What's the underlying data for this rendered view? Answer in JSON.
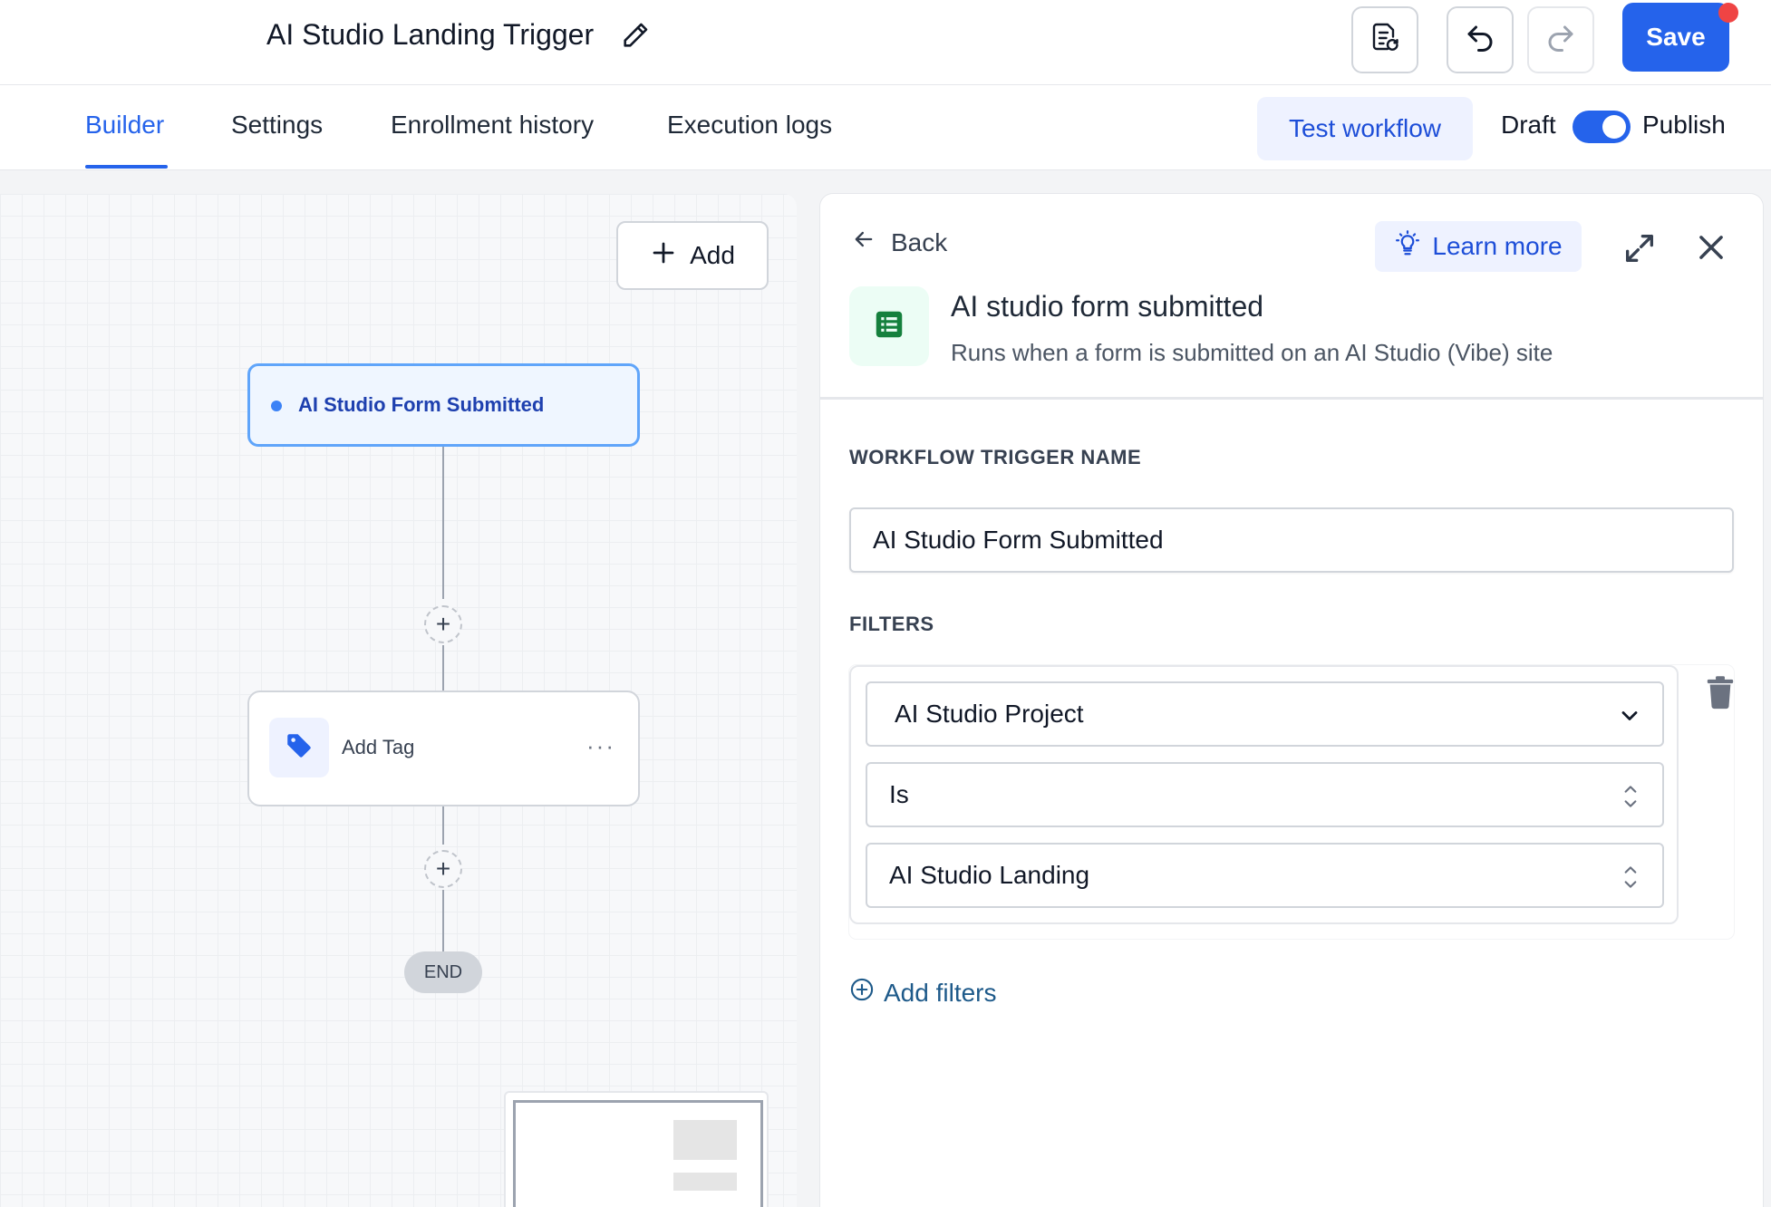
{
  "header": {
    "workflow_title": "AI Studio Landing Trigger",
    "save_label": "Save"
  },
  "tabs": [
    {
      "label": "Builder",
      "active": true
    },
    {
      "label": "Settings",
      "active": false
    },
    {
      "label": "Enrollment history",
      "active": false
    },
    {
      "label": "Execution logs",
      "active": false
    }
  ],
  "actions": {
    "test_workflow_label": "Test workflow",
    "draft_label": "Draft",
    "publish_label": "Publish",
    "publish_enabled": true
  },
  "canvas": {
    "add_label": "Add",
    "trigger_node_label": "AI Studio Form Submitted",
    "action_node_label": "Add Tag",
    "end_label": "END"
  },
  "panel": {
    "back_label": "Back",
    "learn_more_label": "Learn more",
    "trigger_title": "AI studio form submitted",
    "trigger_description": "Runs when a form is submitted on an AI Studio (Vibe) site",
    "name_section_label": "WORKFLOW TRIGGER NAME",
    "name_value": "AI Studio Form Submitted",
    "filters_section_label": "FILTERS",
    "filter_field": "AI Studio Project",
    "filter_operator": "Is",
    "filter_value": "AI Studio Landing",
    "add_filters_label": "Add filters"
  },
  "colors": {
    "accent": "#2563eb",
    "notification_dot": "#ef4444",
    "sheet_icon": "#15803d"
  }
}
